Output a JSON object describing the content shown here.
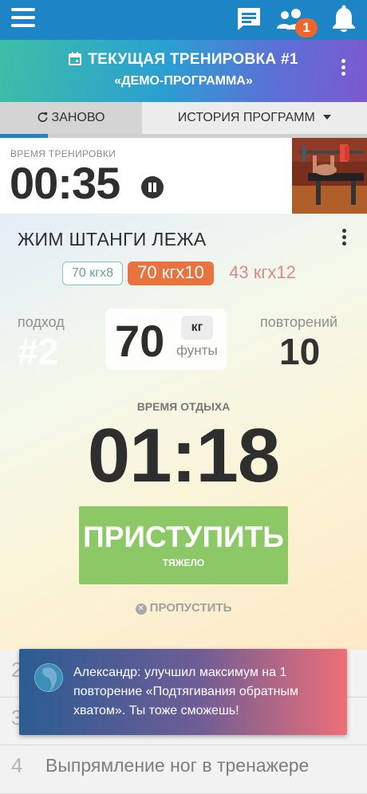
{
  "appbar": {
    "menu_icon": "menu-icon",
    "chat_icon": "chat-icon",
    "friends_icon": "friends-icon",
    "friends_badge": "1",
    "bell_icon": "bell-icon",
    "color": "#1d84c6"
  },
  "workout": {
    "title": "ТЕКУЩАЯ ТРЕНИРОВКА #1",
    "program": "«ДЕМО-ПРОГРАММА»"
  },
  "tabs": {
    "restart": "ЗАНОВО",
    "history": "ИСТОРИЯ ПРОГРАММ"
  },
  "progress": {
    "fraction": 0.13
  },
  "timer": {
    "label": "ВРЕМЯ ТРЕНИРОВКИ",
    "value": "00:35"
  },
  "exercise": {
    "name": "ЖИМ ШТАНГИ ЛЕЖА",
    "sets": [
      {
        "weight": "70 кг",
        "reps": "x8"
      },
      {
        "weight": "70 кг",
        "reps": "x10"
      },
      {
        "weight": "43 кг",
        "reps": "x12"
      }
    ],
    "set_label": "подход",
    "set_number": "#2",
    "weight_value": "70",
    "unit_kg": "кг",
    "unit_lb": "фунты",
    "reps_label": "повторений",
    "reps_value": "10",
    "rest_label": "ВРЕМЯ ОТДЫХА",
    "rest_value": "01:18",
    "start_label": "ПРИСТУПИТЬ",
    "start_sub": "ТЯЖЕЛО",
    "skip_label": "ПРОПУСТИТЬ",
    "accent": "#8cc865",
    "chip_active_color": "#e8733f"
  },
  "list": [
    {
      "num": "2",
      "text": ""
    },
    {
      "num": "3",
      "text": ""
    },
    {
      "num": "4",
      "text": "Выпрямление ног в тренажере"
    }
  ],
  "toast": {
    "text": "Александр: улучшил максимум на 1 повторение «Подтягивания обратным хватом». Ты тоже сможешь!"
  }
}
